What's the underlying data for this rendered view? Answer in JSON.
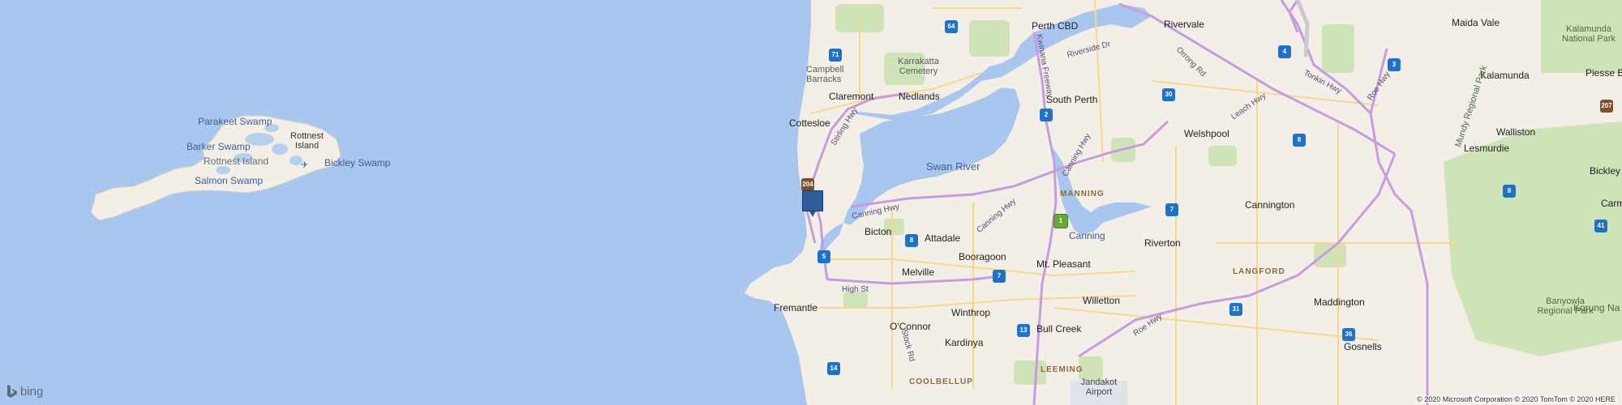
{
  "map": {
    "provider": "bing",
    "copyright": "© 2020 Microsoft Corporation © 2020 TomTom © 2020 HERE",
    "colors": {
      "ocean": "#a9c6ee",
      "land": "#f3efe6",
      "park": "#cfe3b8",
      "motorway": "#c79be0",
      "road": "#f5d98a",
      "marker": "#2f5d9b"
    },
    "marker": {
      "name": "location-pin",
      "color": "#2f5d9b"
    },
    "places": {
      "perth_cbd": "Perth CBD",
      "rivervale": "Rivervale",
      "maida_vale": "Maida Vale",
      "kalamunda_np": "Kalamunda National Park",
      "campbell_barracks": "Campbell Barracks",
      "karrakatta": "Karrakatta Cemetery",
      "claremont": "Claremont",
      "nedlands": "Nedlands",
      "south_perth": "South Perth",
      "kalamunda": "Kalamunda",
      "piesse_brook": "Piesse Br",
      "cottesloe": "Cottesloe",
      "welshpool": "Welshpool",
      "walliston": "Walliston",
      "lesmurdie": "Lesmurdie",
      "bickley": "Bickley",
      "carm": "Carm",
      "manning": "MANNING",
      "cannington": "Cannington",
      "bicton": "Bicton",
      "attadale": "Attadale",
      "canning": "Canning",
      "riverton": "Riverton",
      "langford": "LANGFORD",
      "booragoon": "Booragoon",
      "melville": "Melville",
      "mt_pleasant": "Mt. Pleasant",
      "fremantle": "Fremantle",
      "willetton": "Willetton",
      "maddington": "Maddington",
      "winthrop": "Winthrop",
      "banyowla": "Banyowla Regional Park",
      "korung": "Korung Na",
      "oconnor": "O'Connor",
      "bull_creek": "Bull Creek",
      "kardinya": "Kardinya",
      "gosnells": "Gosnells",
      "leeming": "LEEMING",
      "jandakot": "Jandakot Airport",
      "coolbellup": "COOLBELLUP"
    },
    "water": {
      "parakeet": "Parakeet Swamp",
      "barker": "Barker Swamp",
      "rottnest_island_label": "Rottnest Island",
      "rottnest_island": "Rottnest Island",
      "bickley_swamp": "Bickley Swamp",
      "salmon": "Salmon Swamp",
      "swan_river": "Swan River"
    },
    "roads": {
      "stirling": "Stirling Hwy",
      "canning": "Canning Hwy",
      "kwinana": "Kwinana Freeway",
      "riverside": "Riverside Dr",
      "orrong": "Orrong Rd",
      "tonkin": "Tonkin Hwy",
      "roe": "Roe Hwy",
      "leach": "Leach Hwy",
      "high_st": "High St",
      "stock": "Stock Rd",
      "roe2": "Roe Hwy",
      "mundy": "Mundy Regional Park"
    },
    "shields": [
      "64",
      "71",
      "4",
      "3",
      "30",
      "2",
      "204",
      "207",
      "8",
      "1",
      "7",
      "8",
      "5",
      "8",
      "41",
      "7",
      "31",
      "13",
      "36",
      "14"
    ]
  }
}
